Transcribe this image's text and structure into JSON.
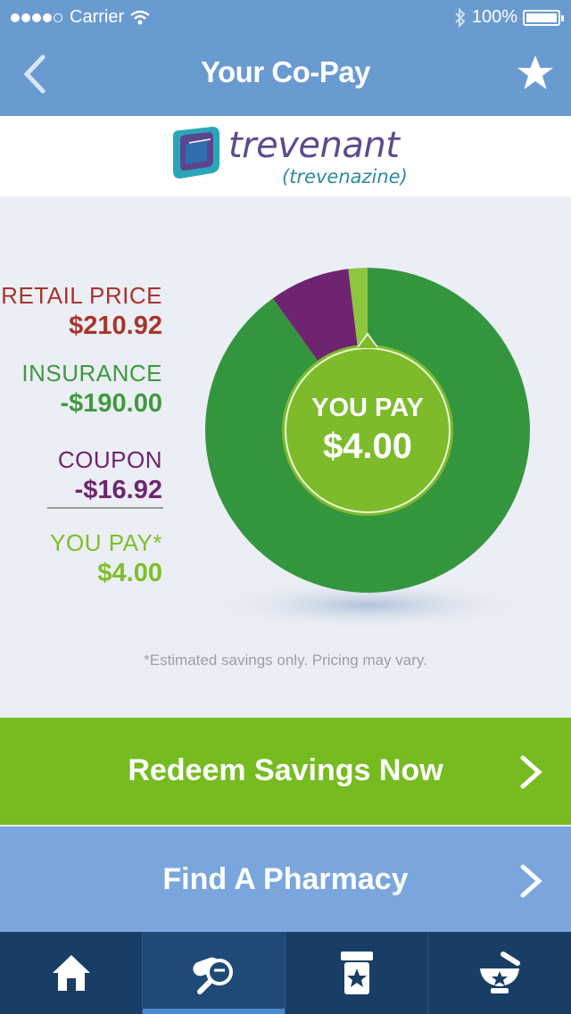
{
  "status_bar": {
    "carrier": "Carrier",
    "battery": "100%",
    "signal_bars": 4,
    "signal_total": 5
  },
  "nav": {
    "title": "Your Co-Pay",
    "back_icon": "chevron-left-icon",
    "favorite_icon": "star-icon"
  },
  "brand": {
    "name": "trevenant",
    "generic": "(trevenazine)"
  },
  "breakdown": [
    {
      "key": "retail",
      "label": "RETAIL PRICE",
      "value": "$210.92",
      "color": "#a8342b"
    },
    {
      "key": "insurance",
      "label": "INSURANCE",
      "value": "-$190.00",
      "color": "#3f9a3e"
    },
    {
      "key": "coupon",
      "label": "COUPON",
      "value": "-$16.92",
      "color": "#6f2470"
    },
    {
      "key": "you_pay",
      "label": "YOU PAY*",
      "value": "$4.00",
      "color": "#7cbf2a"
    }
  ],
  "center": {
    "label": "YOU PAY",
    "value": "$4.00"
  },
  "chart_data": {
    "type": "pie",
    "total": 210.92,
    "slices": [
      {
        "name": "INSURANCE",
        "value": 190.0,
        "color": "#33963f"
      },
      {
        "name": "COUPON",
        "value": 16.92,
        "color": "#6f2470"
      },
      {
        "name": "YOU PAY",
        "value": 4.0,
        "color": "#8dc63f"
      }
    ]
  },
  "footnote": "*Estimated savings only. Pricing may vary.",
  "actions": {
    "redeem": "Redeem Savings Now",
    "pharmacy": "Find A Pharmacy"
  },
  "tabs": [
    {
      "name": "home",
      "icon": "home-icon"
    },
    {
      "name": "search-drug",
      "icon": "pill-search-icon",
      "active": true
    },
    {
      "name": "prescriptions",
      "icon": "prescription-star-icon"
    },
    {
      "name": "pharmacy",
      "icon": "mortar-pestle-icon"
    }
  ]
}
